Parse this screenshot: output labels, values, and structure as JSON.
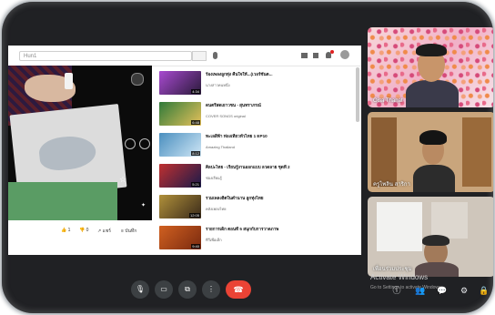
{
  "youtube": {
    "search_placeholder": "Hun1",
    "video_actions": {
      "likes": "1",
      "dislikes": "0",
      "share": "แชร์",
      "save": "บันทึก"
    },
    "recommendations": [
      {
        "title": "ร้องเพลงลูกทุ่ง คืนใจให้...(เวอร์ชันต...",
        "meta": "นางสาวคนหนึ่ง",
        "duration": "4:34",
        "colors": [
          "#a84ad0",
          "#2a1a3a"
        ]
      },
      {
        "title": "ดนตรีสดเยาวชน - สุนทราภรณ์",
        "meta": "COVER SONGS original",
        "duration": "6:48",
        "colors": [
          "#2f7a3a",
          "#e5c15a"
        ]
      },
      {
        "title": "ทะเลสีฟ้า ท่องเที่ยวทั่วไทย 1 EP10",
        "meta": "Amazing Thailand",
        "duration": "8:12",
        "colors": [
          "#4a8fbf",
          "#cfe6f5"
        ]
      },
      {
        "title": "ศิลปะไทย - เรียนรู้งานออกแบบ ลวดลาย ชุดที่ 2",
        "meta": "ช่องเรียนรู้",
        "duration": "5:21",
        "colors": [
          "#c03030",
          "#1a1a4a"
        ]
      },
      {
        "title": "รวมเพลงฮิตในตำนาน ลูกทุ่งไทย",
        "meta": "คลังเพลงไทย",
        "duration": "12:05",
        "colors": [
          "#b0903a",
          "#3a2a1a"
        ]
      },
      {
        "title": "รายการเด็ก ตอนที่ 5 สนุกกับการวาดภาพ",
        "meta": "ทีวีเพื่อเด็ก",
        "duration": "9:40",
        "colors": [
          "#d06020",
          "#7a2a10"
        ]
      }
    ]
  },
  "participants": [
    {
      "name": "Oisa Thanat"
    },
    {
      "name": "ครูไพลิน สาริกา"
    },
    {
      "name": "เพื่อนร่วมประชุม"
    }
  ],
  "watermark": {
    "title": "Activate Windows",
    "subtitle": "Go to Settings to activate Windows."
  },
  "controls": [
    "mic",
    "camera",
    "present",
    "more",
    "end-call"
  ],
  "right_icons": [
    "info",
    "people",
    "chat",
    "activities",
    "lock"
  ]
}
